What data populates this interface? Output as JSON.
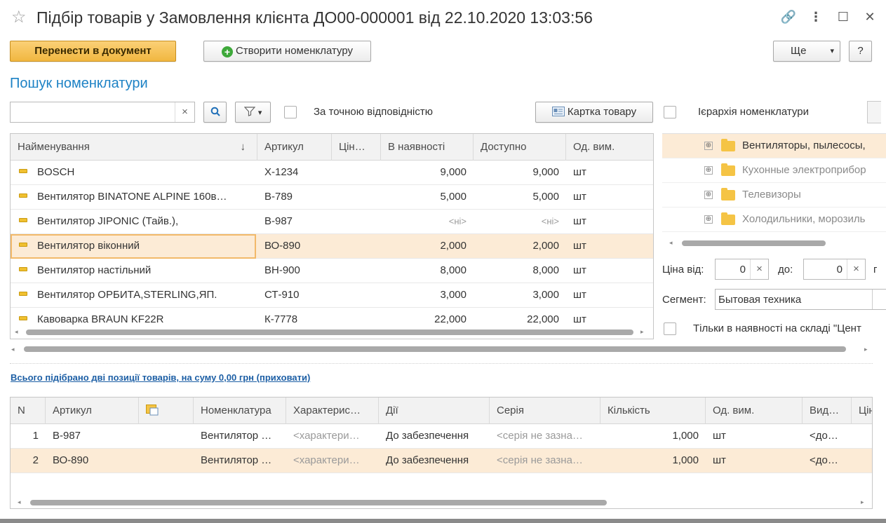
{
  "window": {
    "title": "Підбір товарів у Замовлення клієнта ДО00-000001 від 22.10.2020 13:03:56",
    "star_icon": "☆",
    "link_icon": "🔗",
    "more_icon": "⋮",
    "maximize_icon": "☐",
    "close_icon": "✕"
  },
  "toolbar": {
    "transfer_label": "Перенести в документ",
    "create_label": "Створити номенклатуру",
    "more_label": "Ще",
    "more_caret": "▾",
    "help_label": "?"
  },
  "search": {
    "section_title": "Пошук номенклатури",
    "input_value": "",
    "clear_icon": "×",
    "search_icon": "🔍",
    "filter_caret": "▾",
    "exact_match_label": "За точною відповідністю",
    "product_card_label": "Картка товару"
  },
  "grid": {
    "columns": [
      "Найменування",
      "Артикул",
      "Цін…",
      "В наявності",
      "Доступно",
      "Од. вим."
    ],
    "sort_icon": "↓",
    "rows": [
      {
        "name": "BOSCH",
        "article": "X-1234",
        "price": "",
        "in_stock": "9,000",
        "available": "9,000",
        "unit": "шт"
      },
      {
        "name": "Вентилятор BINATONE ALPINE 160в…",
        "article": "B-789",
        "price": "",
        "in_stock": "5,000",
        "available": "5,000",
        "unit": "шт"
      },
      {
        "name": "Вентилятор JIPONIC (Тайв.),",
        "article": "B-987",
        "price": "",
        "in_stock": "<ні>",
        "available": "<ні>",
        "unit": "шт"
      },
      {
        "name": "Вентилятор віконний",
        "article": "ВО-890",
        "price": "",
        "in_stock": "2,000",
        "available": "2,000",
        "unit": "шт"
      },
      {
        "name": "Вентилятор настільний",
        "article": "ВН-900",
        "price": "",
        "in_stock": "8,000",
        "available": "8,000",
        "unit": "шт"
      },
      {
        "name": "Вентилятор ОРБИТА,STERLING,ЯП.",
        "article": "СТ-910",
        "price": "",
        "in_stock": "3,000",
        "available": "3,000",
        "unit": "шт"
      },
      {
        "name": "Кавоварка BRAUN KF22R",
        "article": "К-7778",
        "price": "",
        "in_stock": "22,000",
        "available": "22,000",
        "unit": "шт"
      }
    ],
    "selected_index": 3
  },
  "hierarchy": {
    "label": "Ієрархія номенклатури",
    "items": [
      {
        "label": "Вентиляторы, пылесосы,"
      },
      {
        "label": "Кухонные электроприбор"
      },
      {
        "label": "Телевизоры"
      },
      {
        "label": "Холодильники, морозиль"
      }
    ],
    "expand_icon": "⊕"
  },
  "filters": {
    "price_from_label": "Ціна від:",
    "price_from_value": "0",
    "price_to_label": "до:",
    "price_to_value": "0",
    "clear_icon": "×",
    "segment_label": "Сегмент:",
    "segment_value": "Бытовая техника",
    "only_in_stock_label": "Тільки в наявності на складі \"Цент"
  },
  "summary": {
    "text": "Всього підібрано дві позиції товарів, на суму 0,00 грн (приховати)"
  },
  "selected_grid": {
    "columns": [
      "N",
      "Артикул",
      "",
      "Номенклатура",
      "Характерис…",
      "Дії",
      "Серія",
      "Кількість",
      "Од. вим.",
      "Вид…",
      "Цін"
    ],
    "rows": [
      {
        "n": "1",
        "article": "В-987",
        "nomenclature": "Вентилятор …",
        "characteristic": "<характери…",
        "action": "До забезпечення",
        "series": "<серія не зазна…",
        "qty": "1,000",
        "unit": "шт",
        "kind": "<до…"
      },
      {
        "n": "2",
        "article": "ВО-890",
        "nomenclature": "Вентилятор …",
        "characteristic": "<характери…",
        "action": "До забезпечення",
        "series": "<серія не зазна…",
        "qty": "1,000",
        "unit": "шт",
        "kind": "<до…"
      }
    ]
  }
}
